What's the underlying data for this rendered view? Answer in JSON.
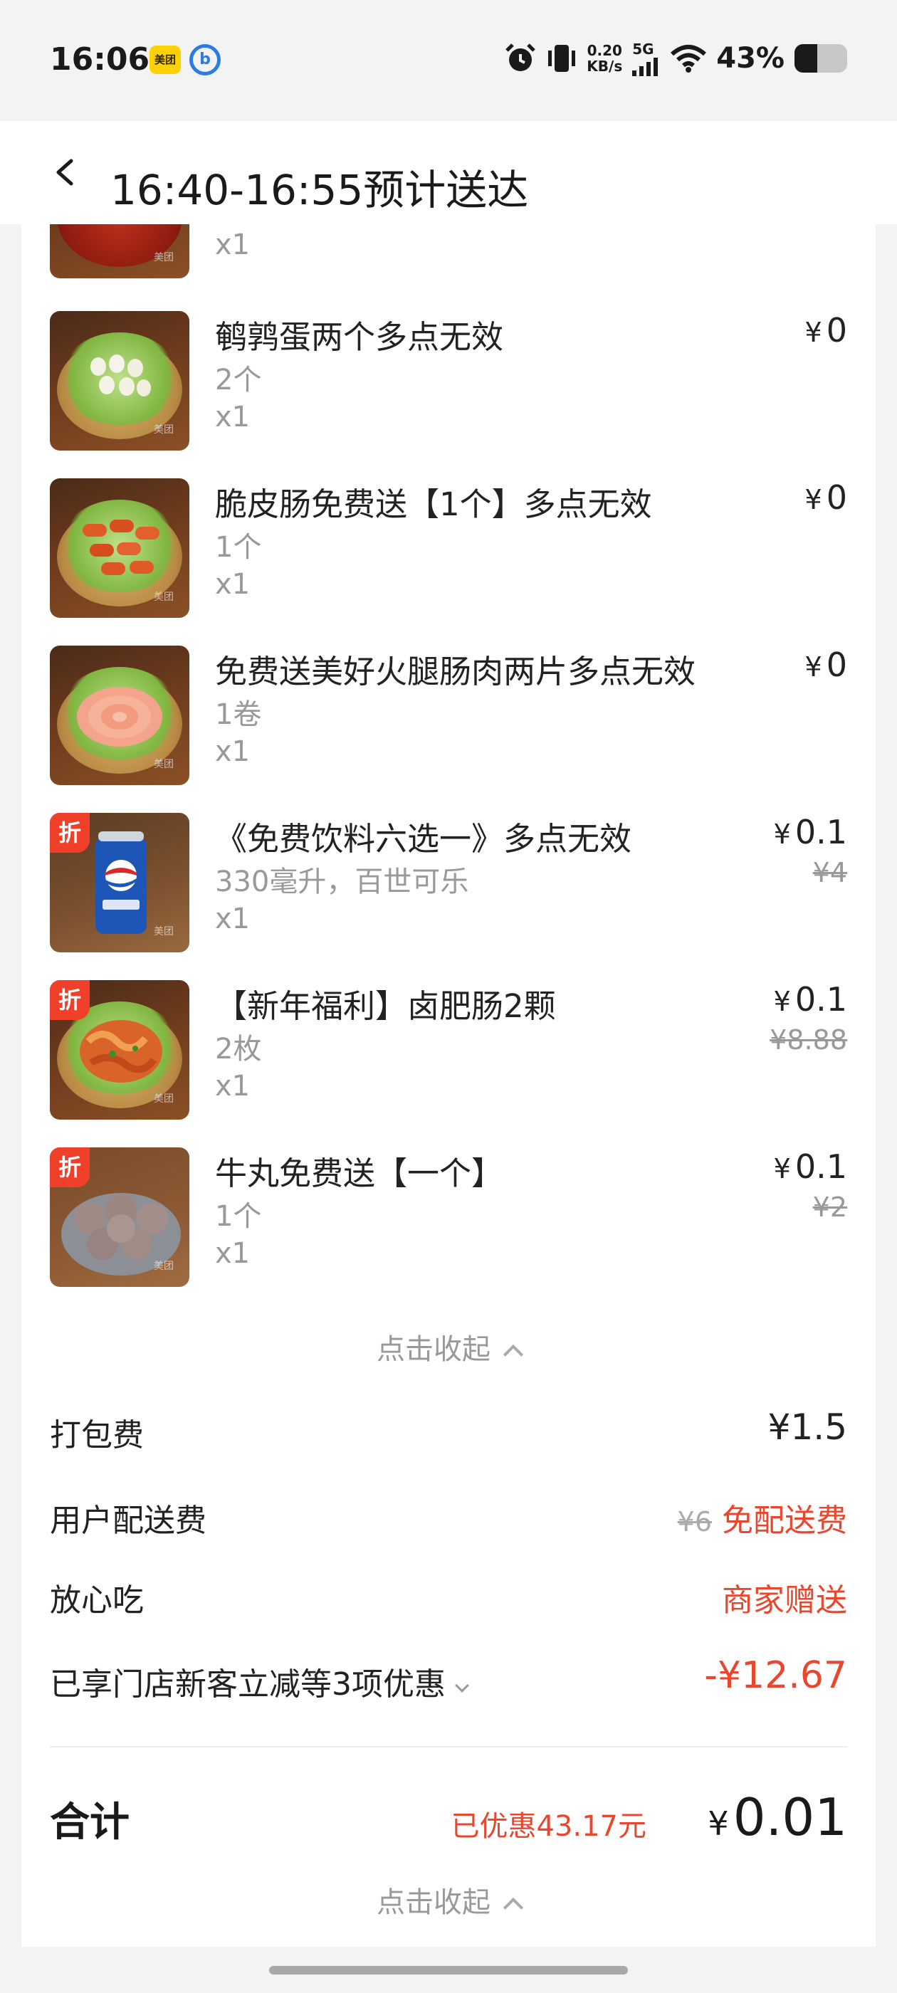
{
  "status_bar": {
    "time": "16:06",
    "app_icon_1": "美团",
    "app_icon_2": "b",
    "net_speed_value": "0.20",
    "net_speed_unit": "KB/s",
    "network": "5G",
    "battery_percent": "43%",
    "battery_level": 0.43,
    "icons": [
      "alarm-icon",
      "vibrate-icon",
      "signal-icon",
      "wifi-icon",
      "battery-icon"
    ]
  },
  "header": {
    "title": "16:40-16:55预计送达"
  },
  "items": [
    {
      "name": "",
      "spec": "",
      "qty": "x1",
      "price": "",
      "orig": "",
      "discount": false
    },
    {
      "name": "鹌鹑蛋两个多点无效",
      "spec": "2个",
      "qty": "x1",
      "price": "0",
      "orig": "",
      "discount": false
    },
    {
      "name": "脆皮肠免费送【1个】多点无效",
      "spec": "1个",
      "qty": "x1",
      "price": "0",
      "orig": "",
      "discount": false
    },
    {
      "name": "免费送美好火腿肠肉两片多点无效",
      "spec": "1卷",
      "qty": "x1",
      "price": "0",
      "orig": "",
      "discount": false
    },
    {
      "name": "《免费饮料六选一》多点无效",
      "spec": "330毫升，百世可乐",
      "qty": "x1",
      "price": "0.1",
      "orig": "¥4",
      "discount": true
    },
    {
      "name": "【新年福利】卤肥肠2颗",
      "spec": "2枚",
      "qty": "x1",
      "price": "0.1",
      "orig": "¥8.88",
      "discount": true
    },
    {
      "name": "牛丸免费送【一个】",
      "spec": "1个",
      "qty": "x1",
      "price": "0.1",
      "orig": "¥2",
      "discount": true
    }
  ],
  "currency": "¥",
  "discount_badge": "折",
  "image_watermark": "美团",
  "collapse_label": "点击收起",
  "fees": {
    "packing_label": "打包费",
    "packing_value": "¥1.5",
    "delivery_label": "用户配送费",
    "delivery_orig": "¥6",
    "delivery_value": "免配送费",
    "safe_label": "放心吃",
    "safe_value": "商家赠送",
    "promo_label": "已享门店新客立减等3项优惠",
    "promo_value": "-¥12.67"
  },
  "total": {
    "label": "合计",
    "saved": "已优惠43.17元",
    "value": "0.01"
  },
  "colors": {
    "accent_red": "#e8472e",
    "badge_red": "#f0402a"
  }
}
